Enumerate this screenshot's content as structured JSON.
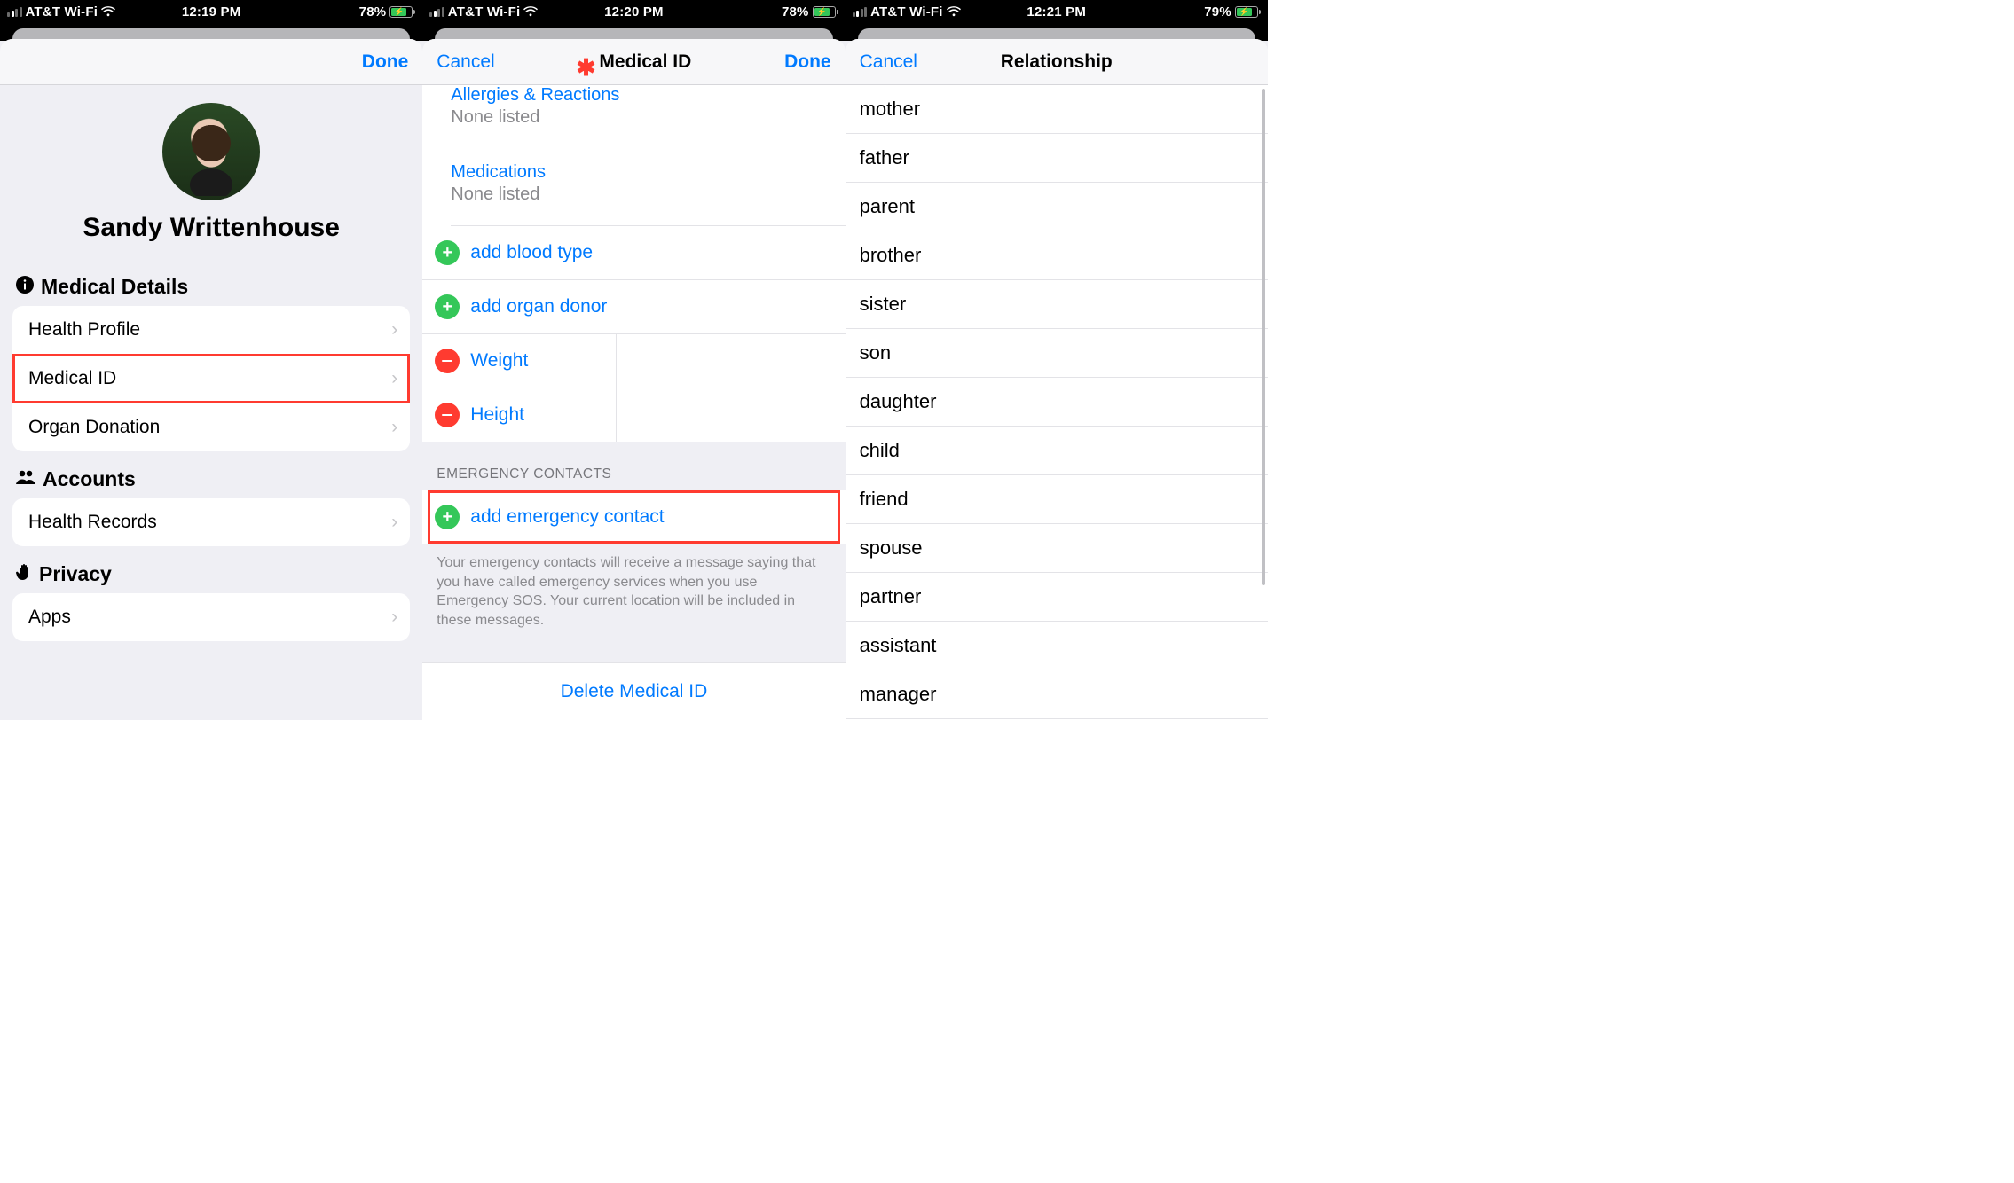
{
  "colors": {
    "accent": "#007aff",
    "danger": "#ff3b30",
    "addGreen": "#34c759",
    "secondaryText": "#8a8a8e"
  },
  "screen1": {
    "statusbar": {
      "carrier": "AT&T Wi-Fi",
      "time": "12:19 PM",
      "battery_pct": "78%"
    },
    "nav": {
      "done": "Done"
    },
    "profile_name": "Sandy Writtenhouse",
    "sections": {
      "medical_details": {
        "title": "Medical Details",
        "rows": {
          "health_profile": "Health Profile",
          "medical_id": "Medical ID",
          "organ_donation": "Organ Donation"
        }
      },
      "accounts": {
        "title": "Accounts",
        "rows": {
          "health_records": "Health Records"
        }
      },
      "privacy": {
        "title": "Privacy",
        "rows": {
          "apps": "Apps"
        }
      }
    }
  },
  "screen2": {
    "statusbar": {
      "carrier": "AT&T Wi-Fi",
      "time": "12:20 PM",
      "battery_pct": "78%"
    },
    "nav": {
      "cancel": "Cancel",
      "title": "Medical ID",
      "done": "Done"
    },
    "allergies": {
      "label": "Allergies & Reactions",
      "value": "None listed"
    },
    "medications": {
      "label": "Medications",
      "value": "None listed"
    },
    "add_blood_type": "add blood type",
    "add_organ_donor": "add organ donor",
    "weight": "Weight",
    "height": "Height",
    "emergency_header": "EMERGENCY CONTACTS",
    "add_emergency": "add emergency contact",
    "footer_note": "Your emergency contacts will receive a message saying that you have called emergency services when you use Emergency SOS. Your current location will be included in these messages.",
    "delete_label": "Delete Medical ID"
  },
  "screen3": {
    "statusbar": {
      "carrier": "AT&T Wi-Fi",
      "time": "12:21 PM",
      "battery_pct": "79%"
    },
    "nav": {
      "cancel": "Cancel",
      "title": "Relationship"
    },
    "options": [
      "mother",
      "father",
      "parent",
      "brother",
      "sister",
      "son",
      "daughter",
      "child",
      "friend",
      "spouse",
      "partner",
      "assistant",
      "manager"
    ]
  }
}
